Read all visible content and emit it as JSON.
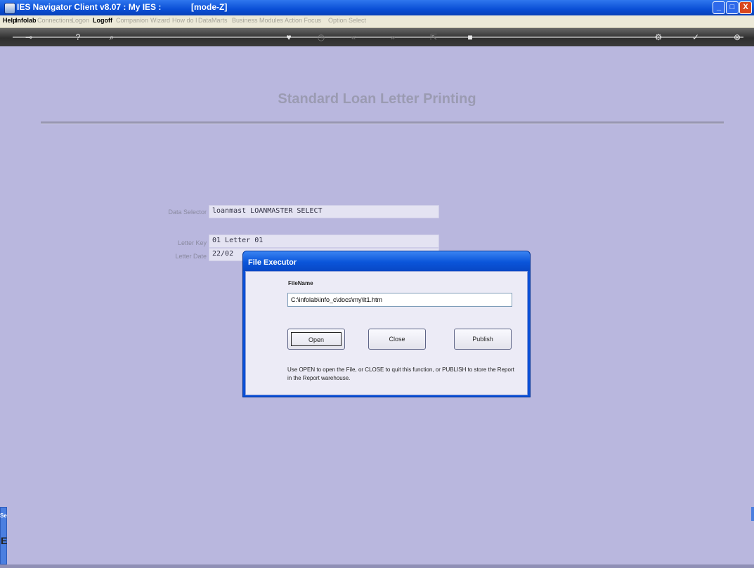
{
  "window": {
    "title": "IES Navigator Client v8.07 : My IES :",
    "mode": "[mode-Z]",
    "min_glyph": "_",
    "max_glyph": "□",
    "close_glyph": "X"
  },
  "menu": {
    "items": [
      "Help",
      "Infolab",
      "Connections",
      "Logon",
      "Logoff",
      "Companion",
      "Wizard",
      "How do I",
      "DataMarts",
      "Business Modules",
      "Action Focus",
      "Option Select"
    ]
  },
  "toolbar": {
    "icons": [
      "key-icon",
      "help-icon",
      "search-icon",
      "heart-icon",
      "clock-icon",
      "rewind-icon",
      "fast-forward-icon",
      "expand-icon",
      "stop-icon",
      "settings-icon",
      "check-icon",
      "close-icon"
    ],
    "glyphs": [
      "⊸",
      "?",
      "⌕",
      "♥",
      "◷",
      "«",
      "»",
      "⇱",
      "■",
      "⚙",
      "✓",
      "⊗"
    ]
  },
  "page": {
    "title": "Standard Loan Letter Printing"
  },
  "form": {
    "data_selector_label": "Data Selector",
    "data_selector_value": "loanmast LOANMASTER SELECT",
    "letter_key_label": "Letter Key",
    "letter_key_value": "01 Letter 01",
    "letter_date_label": "Letter Date",
    "letter_date_value": "22/02"
  },
  "dialog": {
    "title": "File Executor",
    "filename_label": "FileName",
    "filename_value": "C:\\infolab\\info_c\\docs\\my\\lt1.htm",
    "open_label": "Open",
    "close_label": "Close",
    "publish_label": "Publish",
    "help_text": "Use OPEN to open the File, or CLOSE to quit this function, or PUBLISH to store the Report in the Report warehouse."
  },
  "sidebar": {
    "tab_label": "Se",
    "glyph": "E"
  }
}
